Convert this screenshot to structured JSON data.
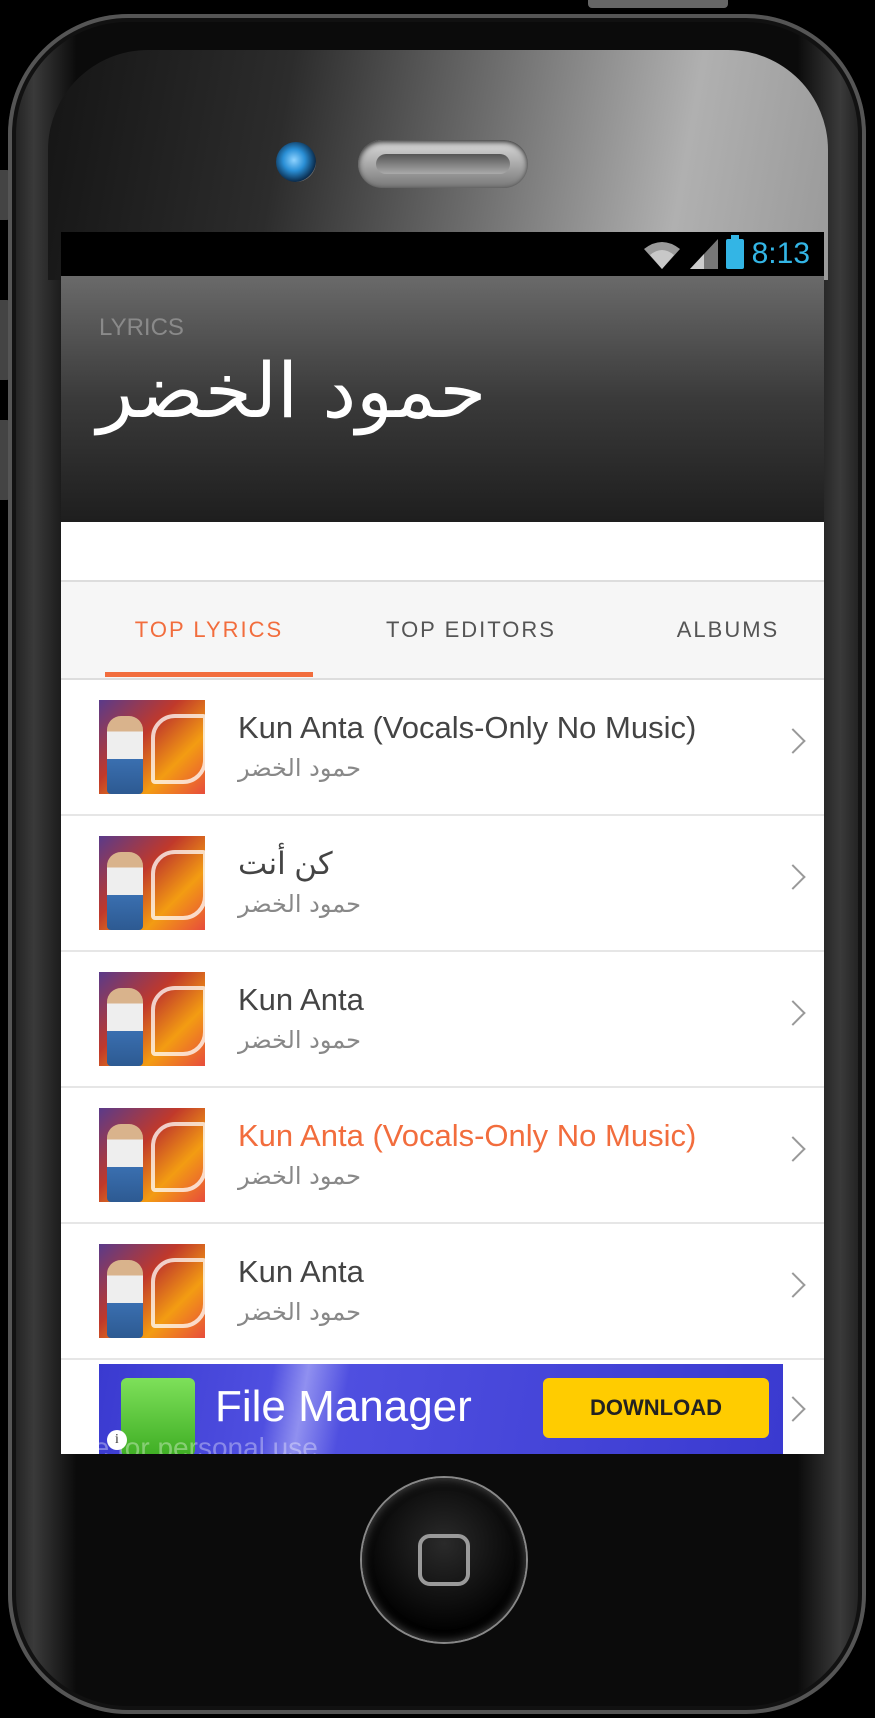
{
  "status_bar": {
    "time": "8:13"
  },
  "header": {
    "label": "LYRICS",
    "title": "حمود الخضر"
  },
  "tabs": [
    {
      "label": "TOP LYRICS",
      "active": true
    },
    {
      "label": "TOP EDITORS",
      "active": false
    },
    {
      "label": "ALBUMS",
      "active": false
    }
  ],
  "songs": [
    {
      "title": "Kun Anta (Vocals-Only No Music)",
      "artist": "حمود الخضر"
    },
    {
      "title": "كن أنت",
      "artist": "حمود الخضر"
    },
    {
      "title": "Kun Anta",
      "artist": "حمود الخضر"
    },
    {
      "title": "Kun Anta (Vocals-Only No Music)",
      "artist": "حمود الخضر"
    },
    {
      "title": "Kun Anta",
      "artist": "حمود الخضر"
    }
  ],
  "ad": {
    "title": "File Manager",
    "cta": "DOWNLOAD",
    "info": "i",
    "watermark": "free for personal use"
  },
  "colors": {
    "accent": "#f26d3d",
    "status_time": "#33b5e5",
    "ad_background": "#3a3ad0",
    "ad_button": "#ffcc00"
  }
}
